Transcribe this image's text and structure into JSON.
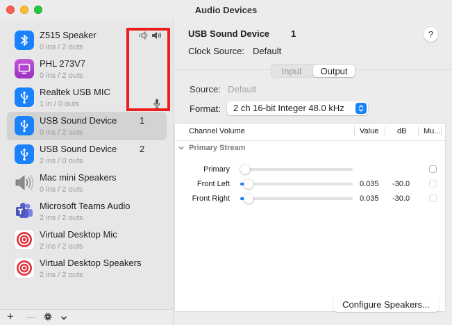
{
  "window": {
    "title": "Audio Devices"
  },
  "sidebar": {
    "devices": [
      {
        "name": "Z515 Speaker",
        "io": "0 ins / 2 outs",
        "num": "",
        "icon": "bluetooth-icon"
      },
      {
        "name": "PHL 273V7",
        "io": "0 ins / 2 outs",
        "num": "",
        "icon": "monitor-icon"
      },
      {
        "name": "Realtek USB MIC",
        "io": "1 in / 0 outs",
        "num": "",
        "icon": "usb-icon"
      },
      {
        "name": "USB Sound Device",
        "io": "0 ins / 2 outs",
        "num": "1",
        "icon": "usb-icon",
        "selected": true
      },
      {
        "name": "USB Sound Device",
        "io": "2 ins / 0 outs",
        "num": "2",
        "icon": "usb-icon"
      },
      {
        "name": "Mac mini Speakers",
        "io": "0 ins / 2 outs",
        "num": "",
        "icon": "speaker-icon"
      },
      {
        "name": "Microsoft Teams Audio",
        "io": "2 ins / 2 outs",
        "num": "",
        "icon": "teams-icon"
      },
      {
        "name": "Virtual Desktop Mic",
        "io": "2 ins / 2 outs",
        "num": "",
        "icon": "target-icon"
      },
      {
        "name": "Virtual Desktop Speakers",
        "io": "2 ins / 2 outs",
        "num": "",
        "icon": "target-icon"
      }
    ],
    "footer": {
      "add": "+",
      "remove": "—"
    }
  },
  "main": {
    "device_title": "USB Sound Device",
    "device_num": "1",
    "help": "?",
    "clock_label": "Clock Source:",
    "clock_value": "Default",
    "tabs": [
      {
        "label": "Input",
        "active": false
      },
      {
        "label": "Output",
        "active": true
      }
    ],
    "source_label": "Source:",
    "source_value": "Default",
    "format_label": "Format:",
    "format_value": "2 ch 16-bit Integer 48.0 kHz",
    "table": {
      "headers": {
        "channel": "Channel Volume",
        "value": "Value",
        "db": "dB",
        "mute": "Mu..."
      },
      "group": "Primary Stream",
      "rows": [
        {
          "label": "Primary",
          "value": "",
          "db": "",
          "level": 0,
          "enabled": true
        },
        {
          "label": "Front Left",
          "value": "0.035",
          "db": "-30.0",
          "level": 0.035,
          "enabled": false
        },
        {
          "label": "Front Right",
          "value": "0.035",
          "db": "-30.0",
          "level": 0.035,
          "enabled": false
        }
      ]
    },
    "configure_button": "Configure Speakers..."
  }
}
